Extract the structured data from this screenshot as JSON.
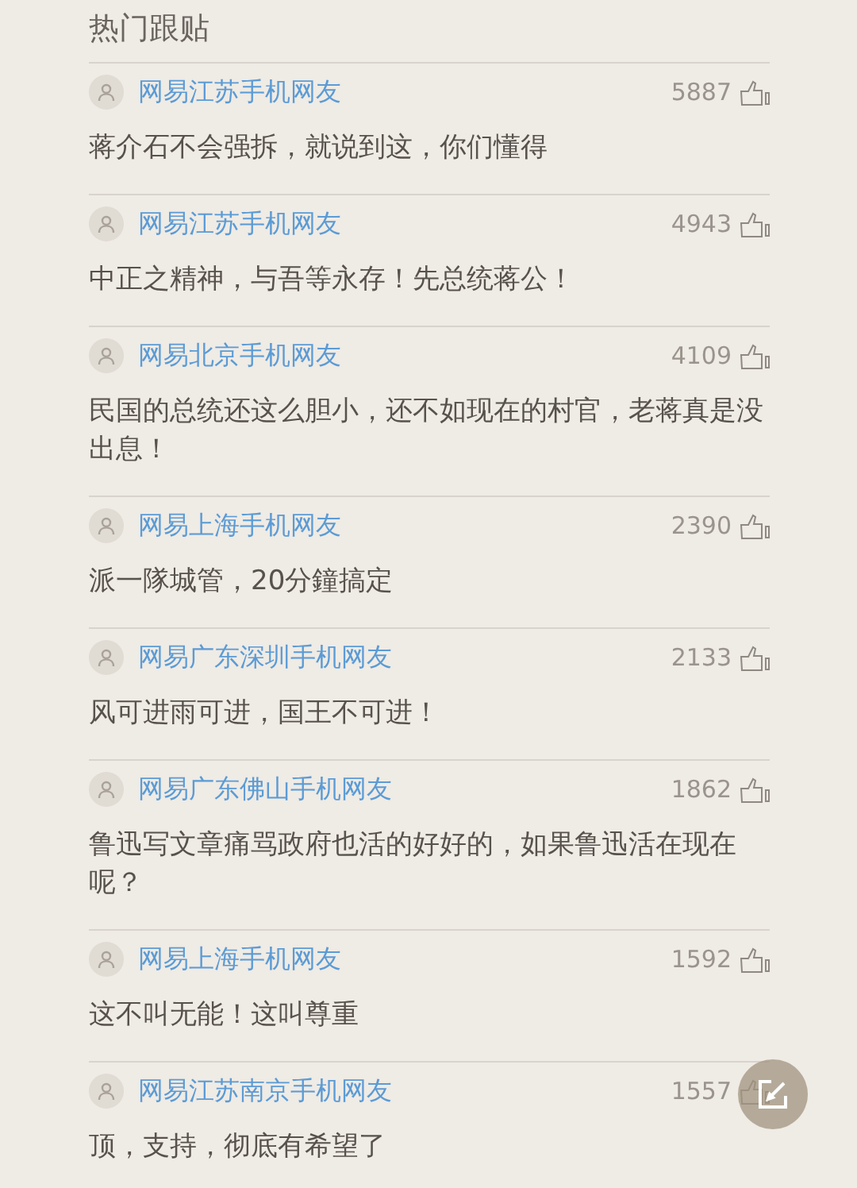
{
  "section_title": "热门跟贴",
  "comments": [
    {
      "user": "网易江苏手机网友",
      "likes": "5887",
      "text": "蒋介石不会强拆，就说到这，你们懂得"
    },
    {
      "user": "网易江苏手机网友",
      "likes": "4943",
      "text": "中正之精神，与吾等永存！先总统蒋公！"
    },
    {
      "user": "网易北京手机网友",
      "likes": "4109",
      "text": "民国的总统还这么胆小，还不如现在的村官，老蒋真是没出息！"
    },
    {
      "user": "网易上海手机网友",
      "likes": "2390",
      "text": "派一隊城管，20分鐘搞定"
    },
    {
      "user": "网易广东深圳手机网友",
      "likes": "2133",
      "text": "风可进雨可进，国王不可进！"
    },
    {
      "user": "网易广东佛山手机网友",
      "likes": "1862",
      "text": "鲁迅写文章痛骂政府也活的好好的，如果鲁迅活在现在呢？"
    },
    {
      "user": "网易上海手机网友",
      "likes": "1592",
      "text": "这不叫无能！这叫尊重"
    },
    {
      "user": "网易江苏南京手机网友",
      "likes": "1557",
      "text": "顶，支持，彻底有希望了"
    }
  ]
}
